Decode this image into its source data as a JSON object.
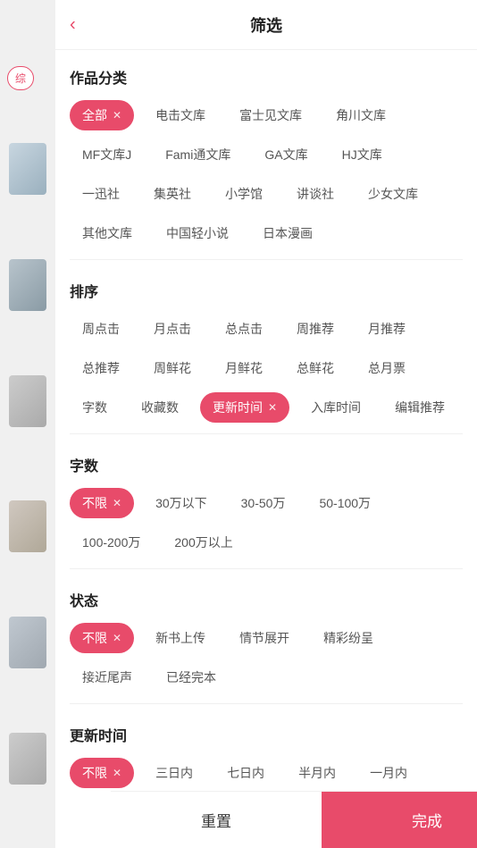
{
  "header": {
    "title": "筛选",
    "back_icon": "‹"
  },
  "sections": {
    "category": {
      "title": "作品分类",
      "tags": [
        {
          "label": "全部",
          "active": true
        },
        {
          "label": "电击文库",
          "active": false
        },
        {
          "label": "富士见文库",
          "active": false
        },
        {
          "label": "角川文库",
          "active": false
        },
        {
          "label": "MF文库J",
          "active": false
        },
        {
          "label": "Fami通文库",
          "active": false
        },
        {
          "label": "GA文库",
          "active": false
        },
        {
          "label": "HJ文库",
          "active": false
        },
        {
          "label": "一迅社",
          "active": false
        },
        {
          "label": "集英社",
          "active": false
        },
        {
          "label": "小学馆",
          "active": false
        },
        {
          "label": "讲谈社",
          "active": false
        },
        {
          "label": "少女文库",
          "active": false
        },
        {
          "label": "其他文库",
          "active": false
        },
        {
          "label": "中国轻小说",
          "active": false
        },
        {
          "label": "日本漫画",
          "active": false
        }
      ]
    },
    "sort": {
      "title": "排序",
      "tags": [
        {
          "label": "周点击",
          "active": false
        },
        {
          "label": "月点击",
          "active": false
        },
        {
          "label": "总点击",
          "active": false
        },
        {
          "label": "周推荐",
          "active": false
        },
        {
          "label": "月推荐",
          "active": false
        },
        {
          "label": "总推荐",
          "active": false
        },
        {
          "label": "周鲜花",
          "active": false
        },
        {
          "label": "月鲜花",
          "active": false
        },
        {
          "label": "总鲜花",
          "active": false
        },
        {
          "label": "总月票",
          "active": false
        },
        {
          "label": "字数",
          "active": false
        },
        {
          "label": "收藏数",
          "active": false
        },
        {
          "label": "更新时间",
          "active": true
        },
        {
          "label": "入库时间",
          "active": false
        },
        {
          "label": "编辑推荐",
          "active": false
        }
      ]
    },
    "words": {
      "title": "字数",
      "tags": [
        {
          "label": "不限",
          "active": true
        },
        {
          "label": "30万以下",
          "active": false
        },
        {
          "label": "30-50万",
          "active": false
        },
        {
          "label": "50-100万",
          "active": false
        },
        {
          "label": "100-200万",
          "active": false
        },
        {
          "label": "200万以上",
          "active": false
        }
      ]
    },
    "status": {
      "title": "状态",
      "tags": [
        {
          "label": "不限",
          "active": true
        },
        {
          "label": "新书上传",
          "active": false
        },
        {
          "label": "情节展开",
          "active": false
        },
        {
          "label": "精彩纷呈",
          "active": false
        },
        {
          "label": "接近尾声",
          "active": false
        },
        {
          "label": "已经完本",
          "active": false
        }
      ]
    },
    "update_time": {
      "title": "更新时间",
      "tags": [
        {
          "label": "不限",
          "active": true
        },
        {
          "label": "三日内",
          "active": false
        },
        {
          "label": "七日内",
          "active": false
        },
        {
          "label": "半月内",
          "active": false
        },
        {
          "label": "一月内",
          "active": false
        }
      ]
    }
  },
  "bottom": {
    "reset_label": "重置",
    "confirm_label": "完成"
  },
  "left_tab": {
    "label": "综"
  }
}
